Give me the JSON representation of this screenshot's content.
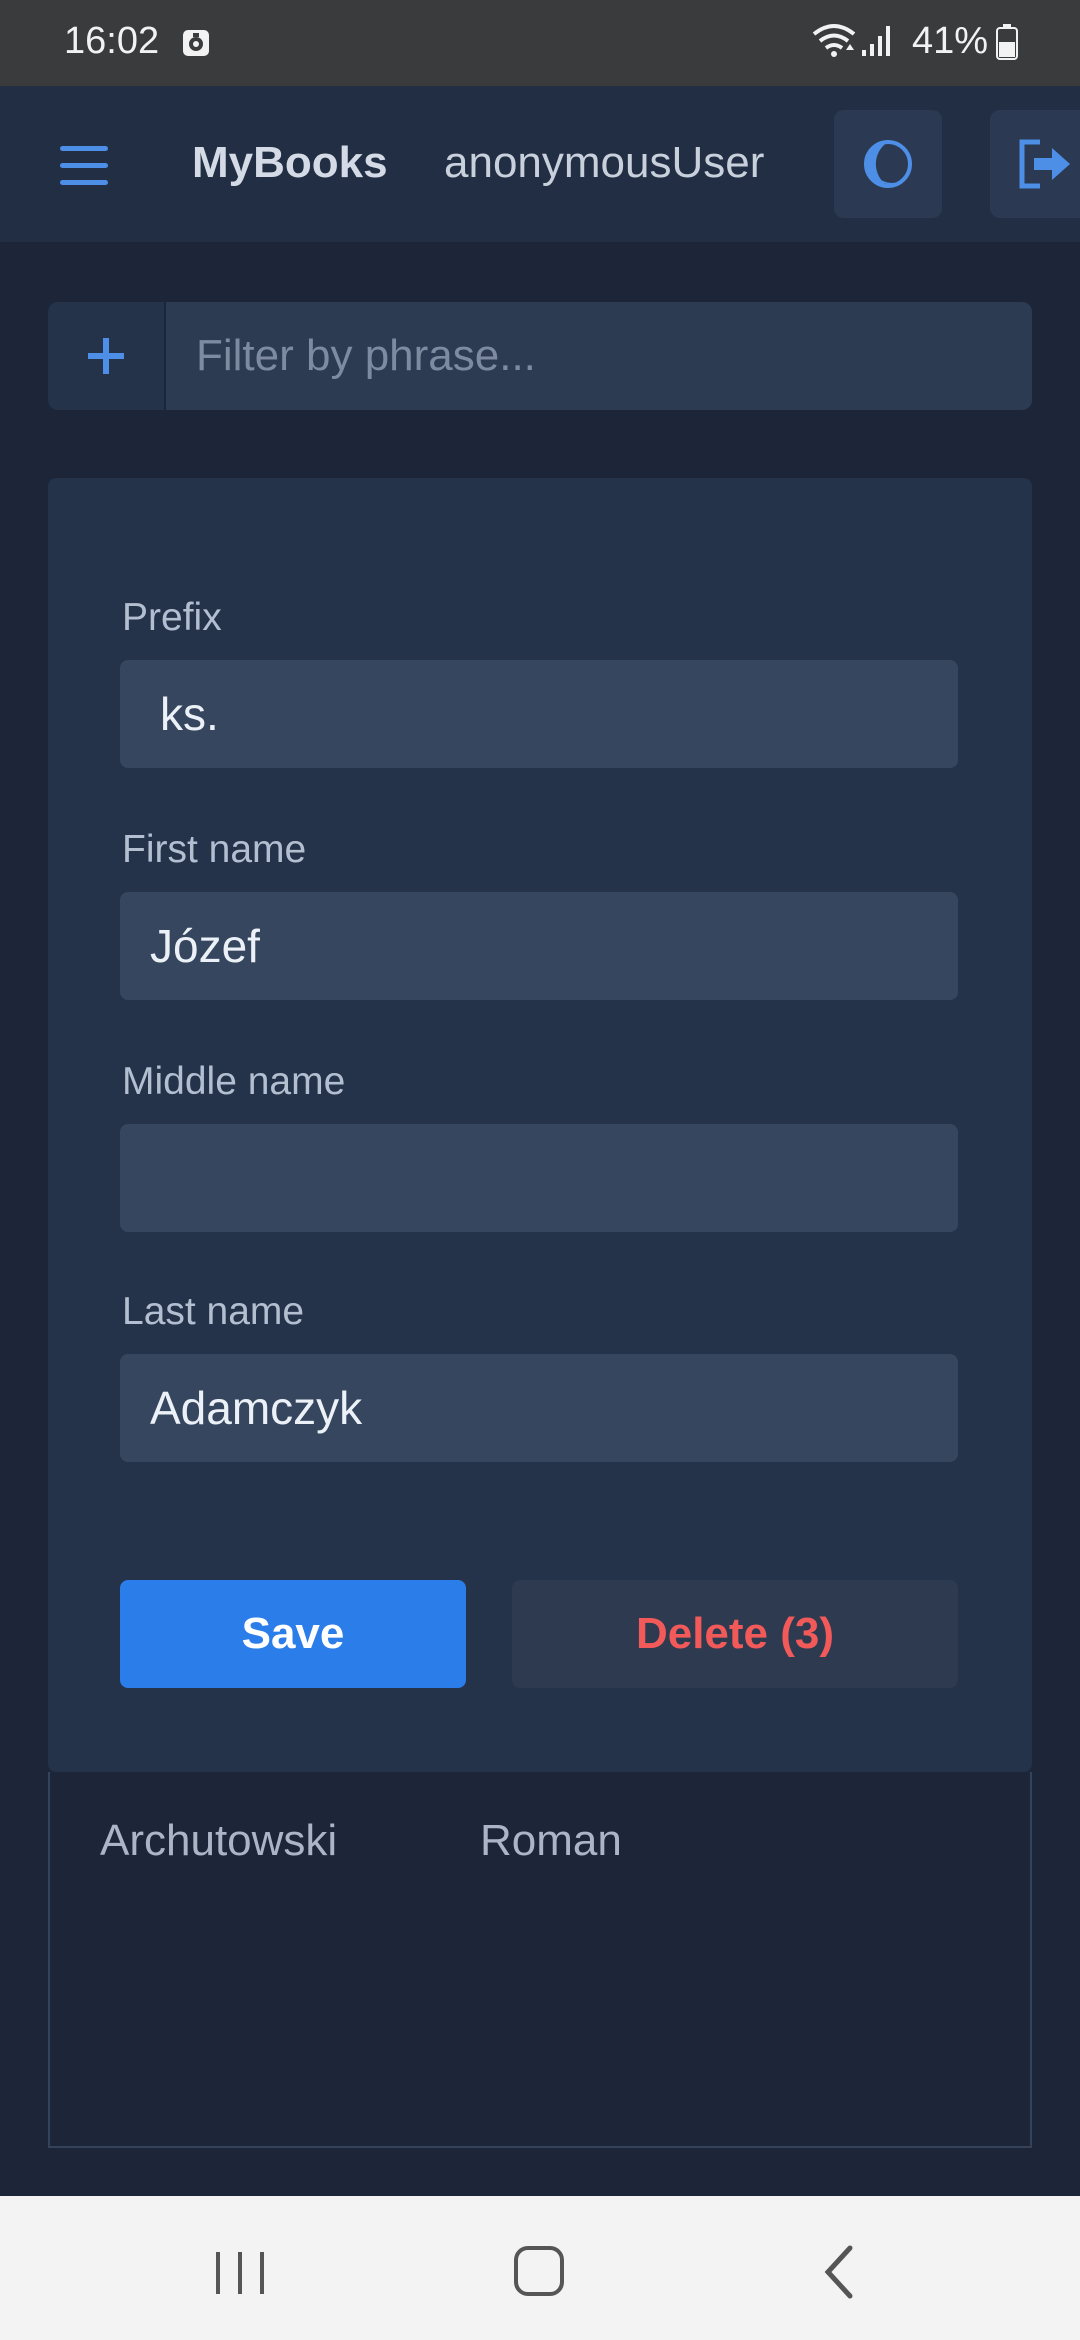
{
  "status_bar": {
    "time": "16:02",
    "battery": "41%",
    "icons": [
      "media-icon",
      "wifi-icon",
      "signal-icon",
      "battery-icon"
    ]
  },
  "header": {
    "app_name": "MyBooks",
    "username": "anonymousUser",
    "icons": [
      "hamburger-menu-icon",
      "moon-icon",
      "logout-icon"
    ]
  },
  "search": {
    "add_icon": "plus-icon",
    "placeholder": "Filter by phrase...",
    "value": ""
  },
  "form": {
    "prefix_label": "Prefix",
    "prefix_value": "ks.",
    "first_name_label": "First name",
    "first_name_value": "Józef",
    "middle_name_label": "Middle name",
    "middle_name_value": "",
    "last_name_label": "Last name",
    "last_name_value": "Adamczyk",
    "save_label": "Save",
    "delete_label": "Delete (3)"
  },
  "list": {
    "rows": [
      {
        "last_name": "Archutowski",
        "first_name": "Roman"
      }
    ]
  },
  "nav": {
    "icons": [
      "recent-apps-icon",
      "home-icon",
      "back-icon"
    ]
  },
  "colors": {
    "background": "#1d2638",
    "panel": "#24324a",
    "accent": "#2b7de9",
    "danger": "#f25a5a"
  }
}
